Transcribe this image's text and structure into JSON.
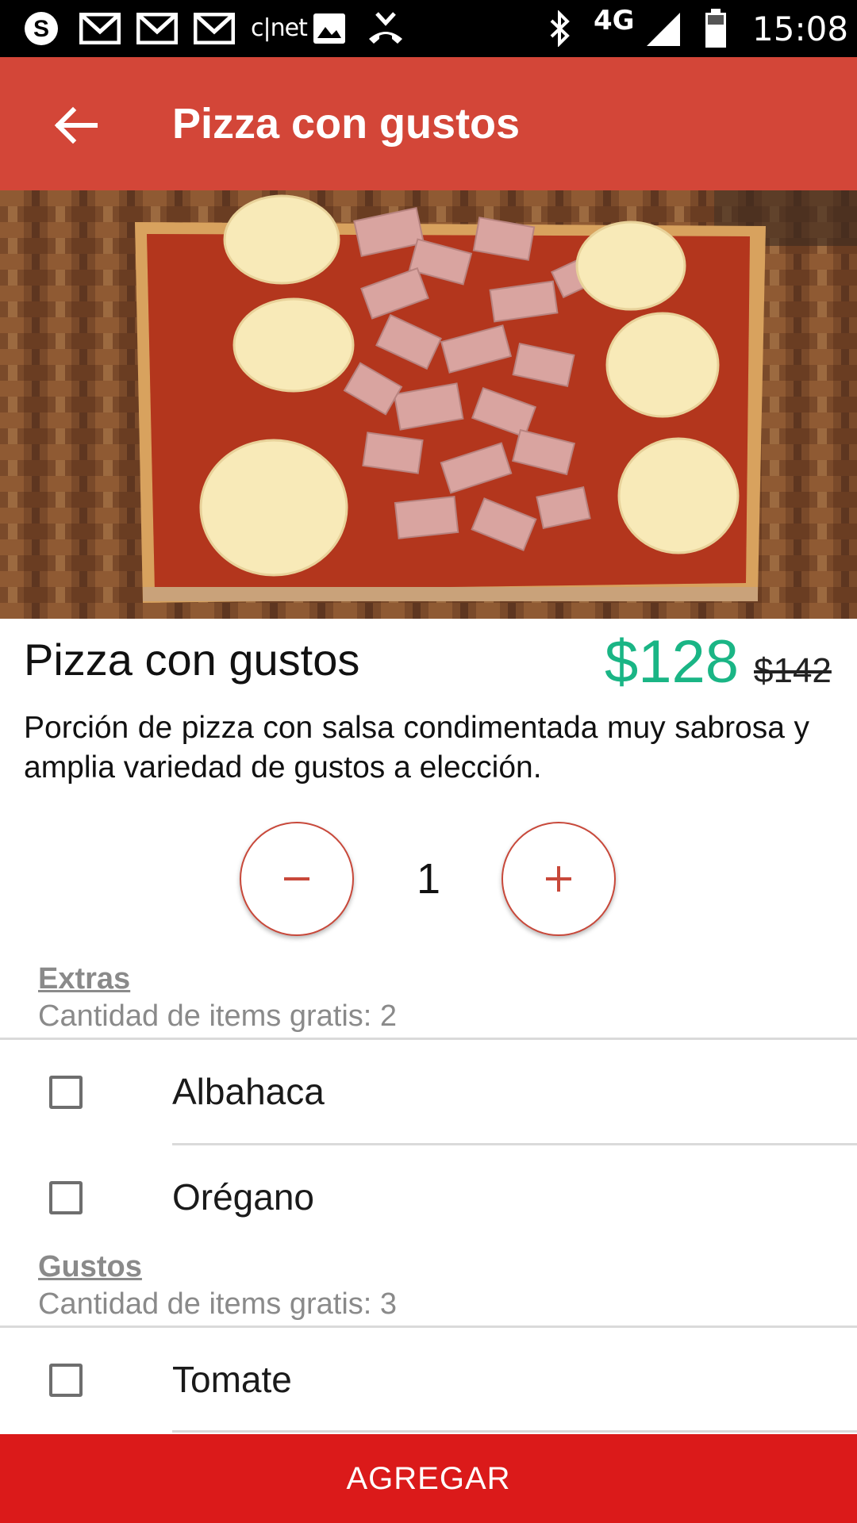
{
  "status_bar": {
    "network": "4G",
    "time": "15:08",
    "icons": [
      "skype-icon",
      "gmail-icon",
      "gmail-icon",
      "gmail-icon",
      "cnet-icon",
      "image-icon",
      "missed-call-icon",
      "bluetooth-icon",
      "signal-icon",
      "battery-icon"
    ],
    "cnet_label": "c|net"
  },
  "app_bar": {
    "title": "Pizza con gustos",
    "background": "#d34638"
  },
  "product": {
    "name": "Pizza con gustos",
    "price": "$128",
    "old_price": "$142",
    "description": "Porción de pizza con salsa condimentada muy sabrosa y amplia variedad de gustos a elección.",
    "price_color": "#1ab585"
  },
  "quantity": {
    "value": "1",
    "minus_label": "−",
    "plus_label": "+"
  },
  "sections": [
    {
      "title": "Extras",
      "subtitle": "Cantidad de items gratis: 2",
      "options": [
        {
          "label": "Albahaca",
          "checked": false
        },
        {
          "label": "Orégano",
          "checked": false
        }
      ]
    },
    {
      "title": "Gustos",
      "subtitle": "Cantidad de items gratis: 3",
      "options": [
        {
          "label": "Tomate",
          "checked": false
        }
      ]
    }
  ],
  "add_button": {
    "label": "AGREGAR",
    "background": "#db1a1a"
  }
}
